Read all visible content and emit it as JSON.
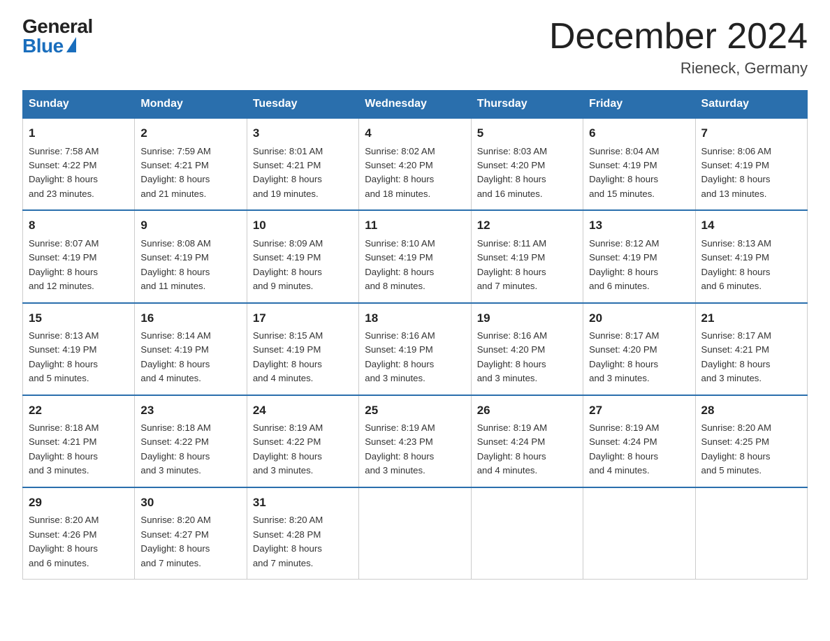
{
  "logo": {
    "general": "General",
    "blue": "Blue"
  },
  "title": "December 2024",
  "location": "Rieneck, Germany",
  "days_of_week": [
    "Sunday",
    "Monday",
    "Tuesday",
    "Wednesday",
    "Thursday",
    "Friday",
    "Saturday"
  ],
  "weeks": [
    [
      {
        "day": "1",
        "sunrise": "7:58 AM",
        "sunset": "4:22 PM",
        "daylight": "8 hours and 23 minutes."
      },
      {
        "day": "2",
        "sunrise": "7:59 AM",
        "sunset": "4:21 PM",
        "daylight": "8 hours and 21 minutes."
      },
      {
        "day": "3",
        "sunrise": "8:01 AM",
        "sunset": "4:21 PM",
        "daylight": "8 hours and 19 minutes."
      },
      {
        "day": "4",
        "sunrise": "8:02 AM",
        "sunset": "4:20 PM",
        "daylight": "8 hours and 18 minutes."
      },
      {
        "day": "5",
        "sunrise": "8:03 AM",
        "sunset": "4:20 PM",
        "daylight": "8 hours and 16 minutes."
      },
      {
        "day": "6",
        "sunrise": "8:04 AM",
        "sunset": "4:19 PM",
        "daylight": "8 hours and 15 minutes."
      },
      {
        "day": "7",
        "sunrise": "8:06 AM",
        "sunset": "4:19 PM",
        "daylight": "8 hours and 13 minutes."
      }
    ],
    [
      {
        "day": "8",
        "sunrise": "8:07 AM",
        "sunset": "4:19 PM",
        "daylight": "8 hours and 12 minutes."
      },
      {
        "day": "9",
        "sunrise": "8:08 AM",
        "sunset": "4:19 PM",
        "daylight": "8 hours and 11 minutes."
      },
      {
        "day": "10",
        "sunrise": "8:09 AM",
        "sunset": "4:19 PM",
        "daylight": "8 hours and 9 minutes."
      },
      {
        "day": "11",
        "sunrise": "8:10 AM",
        "sunset": "4:19 PM",
        "daylight": "8 hours and 8 minutes."
      },
      {
        "day": "12",
        "sunrise": "8:11 AM",
        "sunset": "4:19 PM",
        "daylight": "8 hours and 7 minutes."
      },
      {
        "day": "13",
        "sunrise": "8:12 AM",
        "sunset": "4:19 PM",
        "daylight": "8 hours and 6 minutes."
      },
      {
        "day": "14",
        "sunrise": "8:13 AM",
        "sunset": "4:19 PM",
        "daylight": "8 hours and 6 minutes."
      }
    ],
    [
      {
        "day": "15",
        "sunrise": "8:13 AM",
        "sunset": "4:19 PM",
        "daylight": "8 hours and 5 minutes."
      },
      {
        "day": "16",
        "sunrise": "8:14 AM",
        "sunset": "4:19 PM",
        "daylight": "8 hours and 4 minutes."
      },
      {
        "day": "17",
        "sunrise": "8:15 AM",
        "sunset": "4:19 PM",
        "daylight": "8 hours and 4 minutes."
      },
      {
        "day": "18",
        "sunrise": "8:16 AM",
        "sunset": "4:19 PM",
        "daylight": "8 hours and 3 minutes."
      },
      {
        "day": "19",
        "sunrise": "8:16 AM",
        "sunset": "4:20 PM",
        "daylight": "8 hours and 3 minutes."
      },
      {
        "day": "20",
        "sunrise": "8:17 AM",
        "sunset": "4:20 PM",
        "daylight": "8 hours and 3 minutes."
      },
      {
        "day": "21",
        "sunrise": "8:17 AM",
        "sunset": "4:21 PM",
        "daylight": "8 hours and 3 minutes."
      }
    ],
    [
      {
        "day": "22",
        "sunrise": "8:18 AM",
        "sunset": "4:21 PM",
        "daylight": "8 hours and 3 minutes."
      },
      {
        "day": "23",
        "sunrise": "8:18 AM",
        "sunset": "4:22 PM",
        "daylight": "8 hours and 3 minutes."
      },
      {
        "day": "24",
        "sunrise": "8:19 AM",
        "sunset": "4:22 PM",
        "daylight": "8 hours and 3 minutes."
      },
      {
        "day": "25",
        "sunrise": "8:19 AM",
        "sunset": "4:23 PM",
        "daylight": "8 hours and 3 minutes."
      },
      {
        "day": "26",
        "sunrise": "8:19 AM",
        "sunset": "4:24 PM",
        "daylight": "8 hours and 4 minutes."
      },
      {
        "day": "27",
        "sunrise": "8:19 AM",
        "sunset": "4:24 PM",
        "daylight": "8 hours and 4 minutes."
      },
      {
        "day": "28",
        "sunrise": "8:20 AM",
        "sunset": "4:25 PM",
        "daylight": "8 hours and 5 minutes."
      }
    ],
    [
      {
        "day": "29",
        "sunrise": "8:20 AM",
        "sunset": "4:26 PM",
        "daylight": "8 hours and 6 minutes."
      },
      {
        "day": "30",
        "sunrise": "8:20 AM",
        "sunset": "4:27 PM",
        "daylight": "8 hours and 7 minutes."
      },
      {
        "day": "31",
        "sunrise": "8:20 AM",
        "sunset": "4:28 PM",
        "daylight": "8 hours and 7 minutes."
      },
      null,
      null,
      null,
      null
    ]
  ],
  "labels": {
    "sunrise": "Sunrise: ",
    "sunset": "Sunset: ",
    "daylight": "Daylight: "
  }
}
